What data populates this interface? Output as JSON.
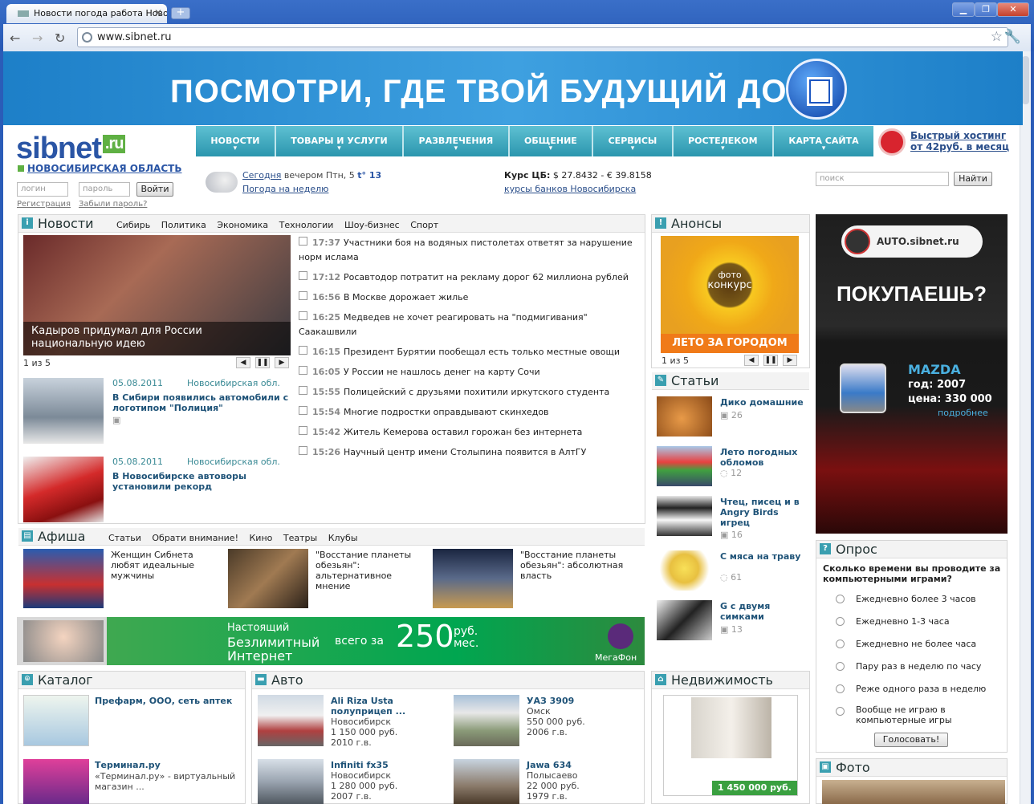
{
  "browser": {
    "tab_title": "Новости погода работа Ново",
    "url": "www.sibnet.ru",
    "window_controls": [
      "minimize-icon",
      "maximize-icon",
      "close-icon"
    ]
  },
  "banner": {
    "text": "ПОСМОТРИ, ГДЕ ТВОЙ БУДУЩИЙ ДОМ"
  },
  "header": {
    "logo": "sibnet",
    "logo_ru": ".ru",
    "region": "НОВОСИБИРСКАЯ ОБЛАСТЬ",
    "menu": [
      "НОВОСТИ",
      "ТОВАРЫ И УСЛУГИ",
      "РАЗВЛЕЧЕНИЯ",
      "ОБЩЕНИЕ",
      "СЕРВИСЫ",
      "РОСТЕЛЕКОМ",
      "КАРТА САЙТА"
    ],
    "hosting_line1": "Быстрый хостинг",
    "hosting_line2": "от 42руб. в месяц"
  },
  "login": {
    "login_placeholder": "логин",
    "password_placeholder": "пароль",
    "submit": "Войти",
    "register": "Регистрация",
    "forgot": "Забыли пароль?"
  },
  "weather": {
    "today_link": "Сегодня",
    "today_text": "вечером Птн, 5",
    "temp": "t° 13",
    "week": "Погода на неделю"
  },
  "rates": {
    "label": "Курс ЦБ:",
    "values": "$ 27.8432 - € 39.8158",
    "banks": "курсы банков Новосибирска"
  },
  "search": {
    "placeholder": "поиск",
    "button": "Найти"
  },
  "news": {
    "title": "Новости",
    "tabs": [
      "Сибирь",
      "Политика",
      "Экономика",
      "Технологии",
      "Шоу-бизнес",
      "Спорт"
    ],
    "featured_caption": "Кадыров придумал для России национальную идею",
    "pager": "1 из 5",
    "items": [
      {
        "time": "17:37",
        "text": "Участники боя на водяных пистолетах ответят за нарушение",
        "text2": "норм ислама"
      },
      {
        "time": "17:12",
        "text": "Росавтодор потратит на рекламу дорог 62 миллиона рублей"
      },
      {
        "time": "16:56",
        "text": "В Москве дорожает жилье"
      },
      {
        "time": "16:25",
        "text": "Медведев не хочет реагировать на \"подмигивания\"",
        "text2": "Саакашвили"
      },
      {
        "time": "16:15",
        "text": "Президент Бурятии пообещал есть только местные овощи"
      },
      {
        "time": "16:05",
        "text": "У России не нашлось денег на карту Сочи"
      },
      {
        "time": "15:55",
        "text": "Полицейский с друзьями похитили иркутского студента"
      },
      {
        "time": "15:54",
        "text": "Многие подростки оправдывают скинхедов"
      },
      {
        "time": "15:42",
        "text": "Житель Кемерова оставил горожан без интернета"
      },
      {
        "time": "15:26",
        "text": "Научный центр имени Столыпина появится в АлтГУ"
      }
    ],
    "regional": [
      {
        "date": "05.08.2011",
        "region": "Новосибирская обл.",
        "title": "В Сибири появились автомобили с логотипом \"Полиция\""
      },
      {
        "date": "05.08.2011",
        "region": "Новосибирская обл.",
        "title": "В Новосибирске автоворы установили рекорд"
      }
    ]
  },
  "afisha": {
    "title": "Афиша",
    "tabs": [
      "Статьи",
      "Обрати внимание!",
      "Кино",
      "Театры",
      "Клубы"
    ],
    "items": [
      "Женщин Сибнета любят идеальные мужчины",
      "\"Восстание планеты обезьян\": альтернативное мнение",
      "\"Восстание планеты обезьян\": абсолютная власть"
    ]
  },
  "megafon": {
    "line1": "Настоящий",
    "line2": "Безлимитный",
    "line3": "Интернет",
    "price_prefix": "всего за",
    "price": "250",
    "unit": "руб.",
    "unit2": "мес.",
    "brand": "МегаФон"
  },
  "anonsy": {
    "title": "Анонсы",
    "poster_top": "фото",
    "poster_mid": "конкурс",
    "poster_bottom": "ЛЕТО ЗА ГОРОДОМ",
    "pager": "1 из 5"
  },
  "articles": {
    "title": "Статьи",
    "items": [
      {
        "title": "Дико домашние",
        "count": "26"
      },
      {
        "title": "Лето погодных обломов",
        "count": "12"
      },
      {
        "title": "Чтец, писец и в Angry Birds игрец",
        "count": "16"
      },
      {
        "title": "С мяса на траву",
        "count": "61"
      },
      {
        "title": "G с двумя симками",
        "count": "13"
      }
    ]
  },
  "auto_ad": {
    "brand": "AUTO.sibnet.ru",
    "question": "ПОКУПАЕШЬ?",
    "model": "MAZDA",
    "year": "год: 2007",
    "price": "цена: 330 000",
    "more": "подробнее"
  },
  "poll": {
    "title": "Опрос",
    "question": "Сколько времени вы проводите за компьютерными играми?",
    "options": [
      "Ежедневно более 3 часов",
      "Ежедневно 1-3 часа",
      "Ежедневно не более часа",
      "Пару раз в неделю по часу",
      "Реже одного раза в неделю",
      "Вообще не играю в компьютерные игры"
    ],
    "vote": "Голосовать!"
  },
  "catalog": {
    "title": "Каталог",
    "items": [
      {
        "title": "Префарм, ООО, сеть аптек",
        "desc": ""
      },
      {
        "title": "Терминал.ру",
        "desc": "«Терминал.ру» - виртуальный магазин ..."
      }
    ]
  },
  "auto": {
    "title": "Авто",
    "items": [
      {
        "title": "Ali Riza Usta полуприцеп ...",
        "city": "Новосибирск",
        "price": "1 150 000 руб.",
        "year": "2010 г.в."
      },
      {
        "title": "УАЗ 3909",
        "city": "Омск",
        "price": "550 000 руб.",
        "year": "2006 г.в."
      },
      {
        "title": "Infiniti fx35",
        "city": "Новосибирск",
        "price": "1 280 000 руб.",
        "year": "2007 г.в."
      },
      {
        "title": "Jawa 634",
        "city": "Полысаево",
        "price": "22 000 руб.",
        "year": "1979 г.в."
      }
    ]
  },
  "realty": {
    "title": "Недвижимость",
    "price": "1 450 000 руб."
  },
  "photo": {
    "title": "Фото"
  },
  "colors": {
    "accent": "#2b96ae",
    "link": "#1f5378",
    "brand": "#2a55a5"
  }
}
